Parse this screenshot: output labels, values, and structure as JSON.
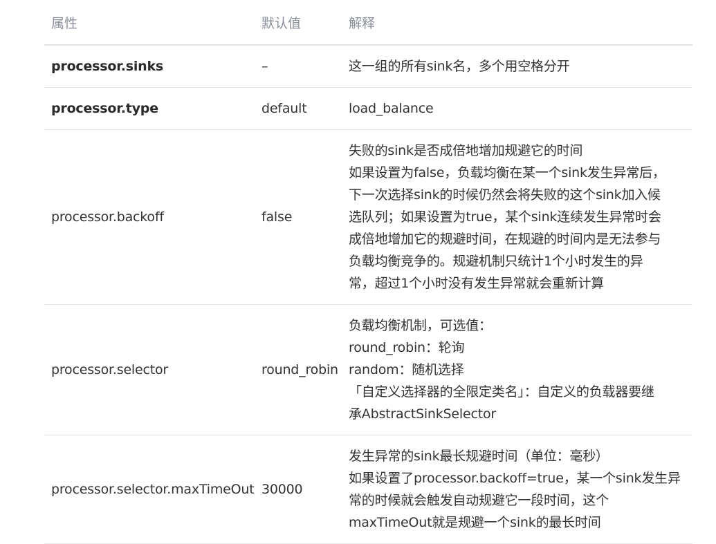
{
  "table": {
    "headers": [
      "属性",
      "默认值",
      "解释"
    ],
    "rows": [
      {
        "name": "processor.sinks",
        "bold": true,
        "default": "–",
        "desc": [
          "这一组的所有sink名，多个用空格分开"
        ]
      },
      {
        "name": "processor.type",
        "bold": true,
        "default": "default",
        "desc": [
          "load_balance"
        ]
      },
      {
        "name": "processor.backoff",
        "bold": false,
        "default": "false",
        "desc": [
          "失败的sink是否成倍地增加规避它的时间",
          "如果设置为false，负载均衡在某一个sink发生异常后，",
          "下一次选择sink的时候仍然会将失败的这个sink加入候",
          "选队列；如果设置为true，某个sink连续发生异常时会",
          "成倍地增加它的规避时间，在规避的时间内是无法参与",
          "负载均衡竞争的。规避机制只统计1个小时发生的异",
          "常，超过1个小时没有发生异常就会重新计算"
        ]
      },
      {
        "name": "processor.selector",
        "bold": false,
        "default": "round_robin",
        "desc": [
          "负载均衡机制，可选值：",
          "round_robin：轮询",
          "random：随机选择",
          "「自定义选择器的全限定类名」：自定义的负载器要继",
          "承AbstractSinkSelector"
        ]
      },
      {
        "name": "processor.selector.maxTimeOut",
        "bold": false,
        "default": "30000",
        "desc": [
          "发生异常的sink最长规避时间（单位：毫秒）",
          "如果设置了processor.backoff=true，某一个sink发生异",
          "常的时候就会触发自动规避它一段时间，这个",
          "maxTimeOut就是规避一个sink的最长时间"
        ]
      }
    ]
  }
}
